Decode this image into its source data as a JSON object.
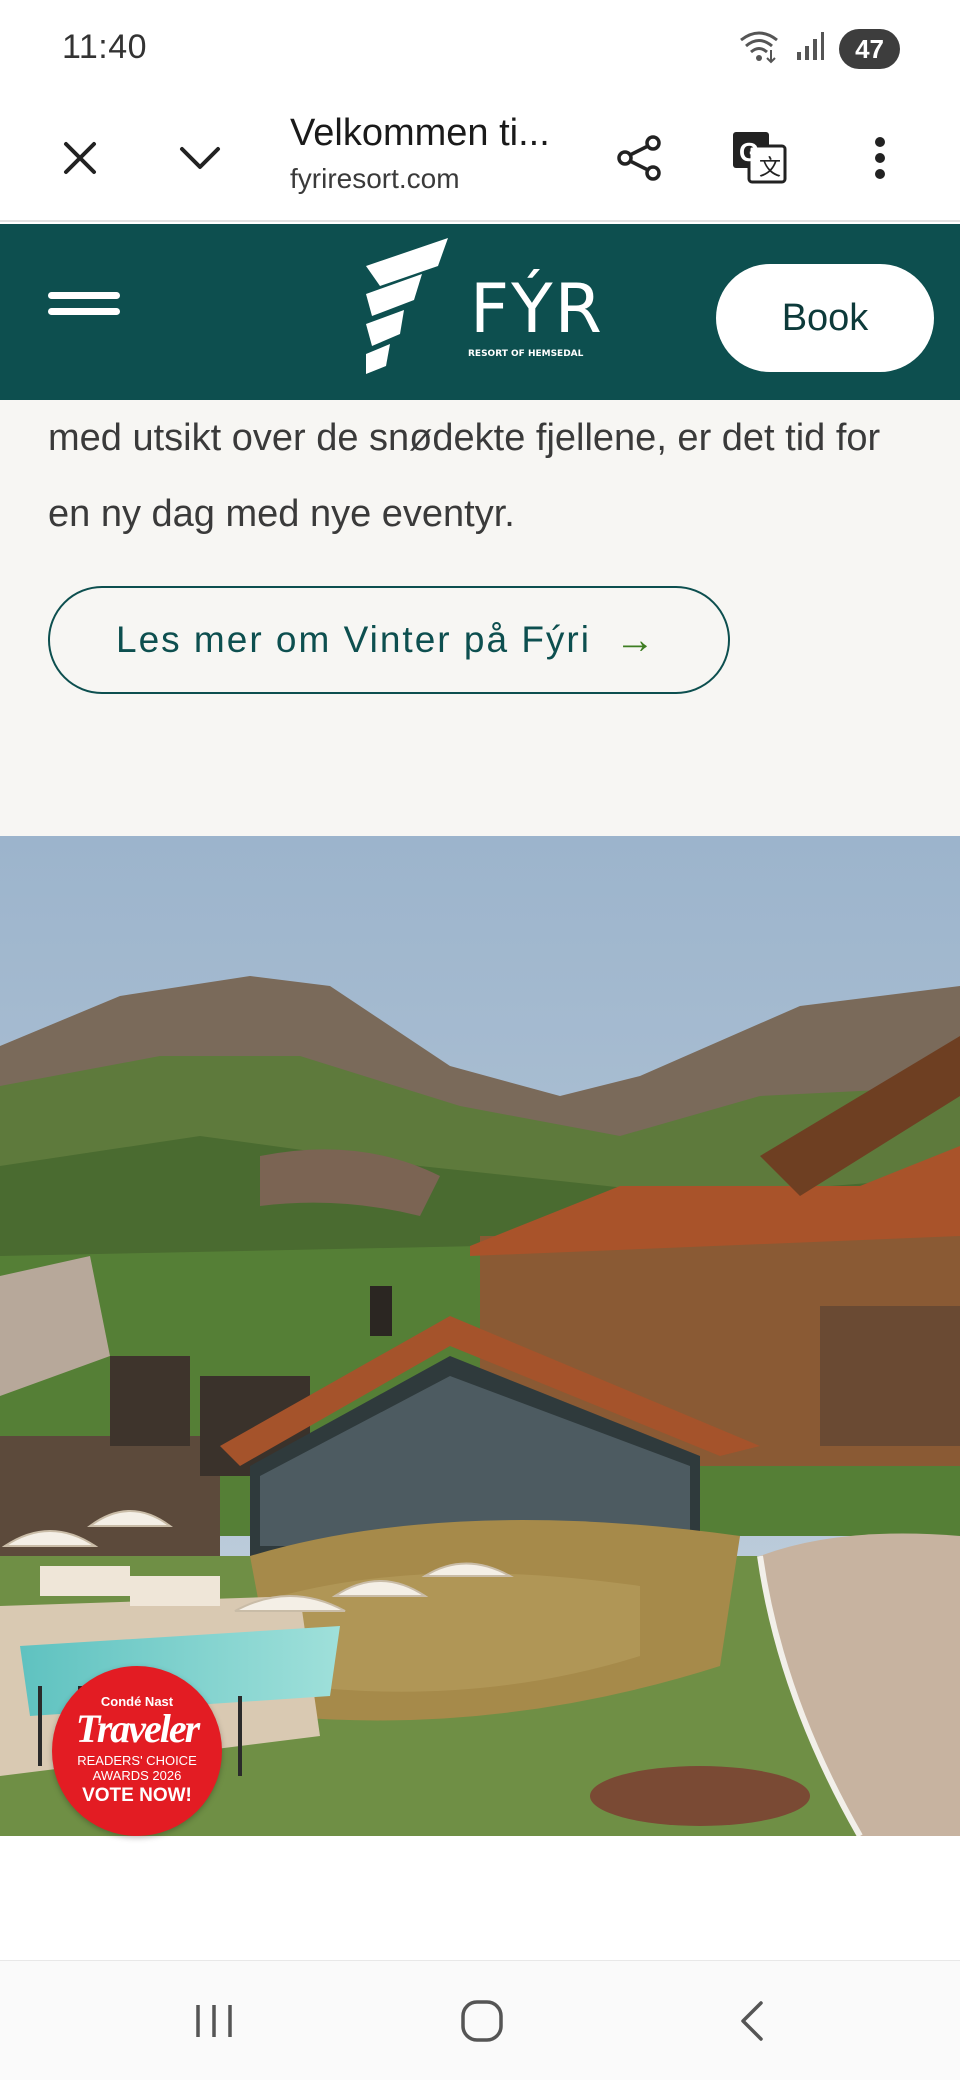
{
  "status_bar": {
    "time": "11:40",
    "battery": "47",
    "icons": [
      "wifi-icon",
      "signal-icon",
      "battery-icon"
    ]
  },
  "browser": {
    "page_title": "Velkommen ti...",
    "url": "fyriresort.com",
    "buttons": [
      "close-icon",
      "chevron-down-icon",
      "share-icon",
      "translate-icon",
      "more-icon"
    ]
  },
  "site_header": {
    "logo_text": "FÝRI",
    "logo_subtitle": "RESORT OF HEMSEDAL",
    "book_label": "Book",
    "colors": {
      "header_bg": "#0d4f4f",
      "button_bg": "#ffffff"
    }
  },
  "content": {
    "paragraph": "med utsikt over de snødekte fjellene, er det tid for en ny dag med nye eventyr.",
    "cta_label": "Les mer om Vinter på Fýri",
    "cta_arrow": "→",
    "colors": {
      "section_bg": "#f7f6f3",
      "accent": "#0d4f4f",
      "arrow": "#3e7d22"
    }
  },
  "badge": {
    "line1": "Condé Nast",
    "line2": "Traveler",
    "line3": "READERS' CHOICE",
    "line4": "AWARDS 2026",
    "line5": "VOTE NOW!",
    "color": "#e31c23"
  },
  "nav_bar": {
    "buttons": [
      "recents-icon",
      "home-icon",
      "back-icon"
    ]
  }
}
